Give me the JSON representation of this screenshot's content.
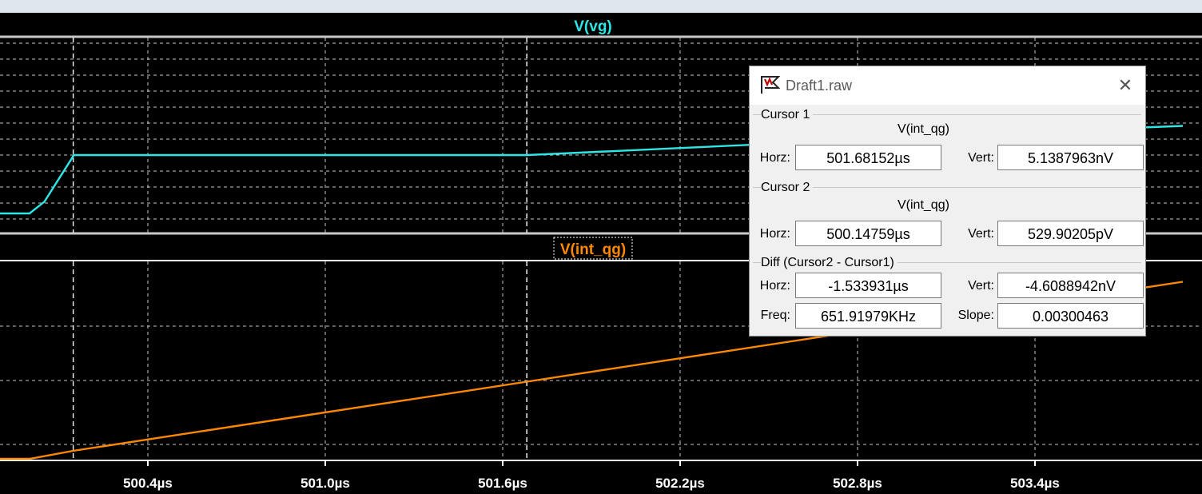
{
  "dialog": {
    "title": "Draft1.raw",
    "cursor1": {
      "label": "Cursor 1",
      "trace": "V(int_qg)",
      "horz_label": "Horz:",
      "horz": "501.68152µs",
      "vert_label": "Vert:",
      "vert": "5.1387963nV"
    },
    "cursor2": {
      "label": "Cursor 2",
      "trace": "V(int_qg)",
      "horz_label": "Horz:",
      "horz": "500.14759µs",
      "vert_label": "Vert:",
      "vert": "529.90205pV"
    },
    "diff": {
      "label": "Diff (Cursor2 - Cursor1)",
      "horz_label": "Horz:",
      "horz": "-1.533931µs",
      "vert_label": "Vert:",
      "vert": "-4.6088942nV",
      "freq_label": "Freq:",
      "freq": "651.91979KHz",
      "slope_label": "Slope:",
      "slope": "0.00300463"
    }
  },
  "chart_data": {
    "type": "line",
    "panes": [
      {
        "title": "V(vg)",
        "color": "#2ee6e6"
      },
      {
        "title": "V(int_qg)",
        "color": "#ff8800",
        "selected": true
      }
    ],
    "x_ticks": [
      "500.4µs",
      "501.0µs",
      "501.6µs",
      "502.2µs",
      "502.8µs",
      "503.4µs"
    ],
    "x_tick_values": [
      500.4,
      501.0,
      501.6,
      502.2,
      502.8,
      503.4
    ],
    "x_unit": "µs",
    "xlim": [
      499.9,
      503.9
    ],
    "cursors_x": [
      500.1476,
      501.6815
    ],
    "series": [
      {
        "trace": "V(vg)",
        "x": [
          499.9,
          500.0,
          500.05,
          500.1,
          500.15,
          501.6815,
          502.2,
          502.8,
          503.4,
          503.9
        ],
        "y": [
          0.0,
          0.0,
          0.2,
          0.6,
          1.0,
          1.0,
          1.12,
          1.26,
          1.4,
          1.5
        ]
      },
      {
        "trace": "V(int_qg)",
        "x": [
          499.9,
          500.0,
          500.1476,
          501.6815,
          502.2,
          502.8,
          503.4,
          503.9
        ],
        "y": [
          0.0,
          0.0,
          0.53,
          5.14,
          6.7,
          8.5,
          10.3,
          11.8
        ]
      }
    ],
    "grid": true
  },
  "icons": {
    "dialog": "ltspice-flag-icon",
    "close": "close-icon"
  }
}
